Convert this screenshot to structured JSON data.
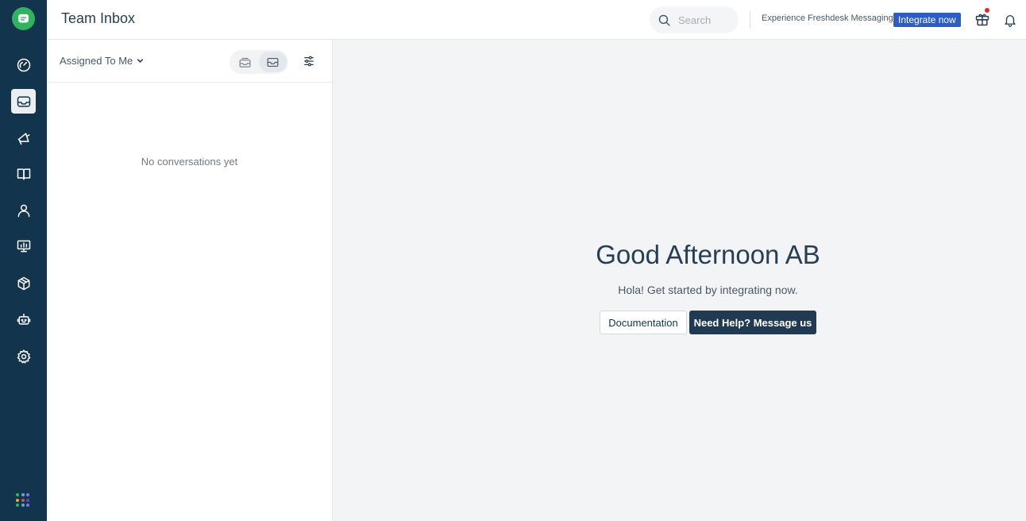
{
  "header": {
    "title": "Team Inbox",
    "search_placeholder": "Search",
    "promo_text": "Experience Freshdesk Messaging",
    "integrate_label": "Integrate now"
  },
  "nav": {
    "items": [
      {
        "icon": "dashboard-icon",
        "active": false
      },
      {
        "icon": "inbox-icon",
        "active": true
      },
      {
        "icon": "campaigns-icon",
        "active": false
      },
      {
        "icon": "knowledge-base-icon",
        "active": false
      },
      {
        "icon": "contacts-icon",
        "active": false
      },
      {
        "icon": "reports-icon",
        "active": false
      },
      {
        "icon": "integrations-icon",
        "active": false
      },
      {
        "icon": "bot-icon",
        "active": false
      },
      {
        "icon": "settings-icon",
        "active": false
      }
    ]
  },
  "list": {
    "filter_label": "Assigned To Me",
    "empty_text": "No conversations yet"
  },
  "main": {
    "greeting": "Good Afternoon AB",
    "subtext": "Hola! Get started by integrating now.",
    "documentation_label": "Documentation",
    "help_label": "Need Help? Message us"
  },
  "colors": {
    "nav_bg": "#12344d",
    "brand_green": "#2fb35f",
    "accent_blue": "#2c5cc5",
    "help_button": "#1f3a52",
    "notification_dot": "#d72d30"
  }
}
